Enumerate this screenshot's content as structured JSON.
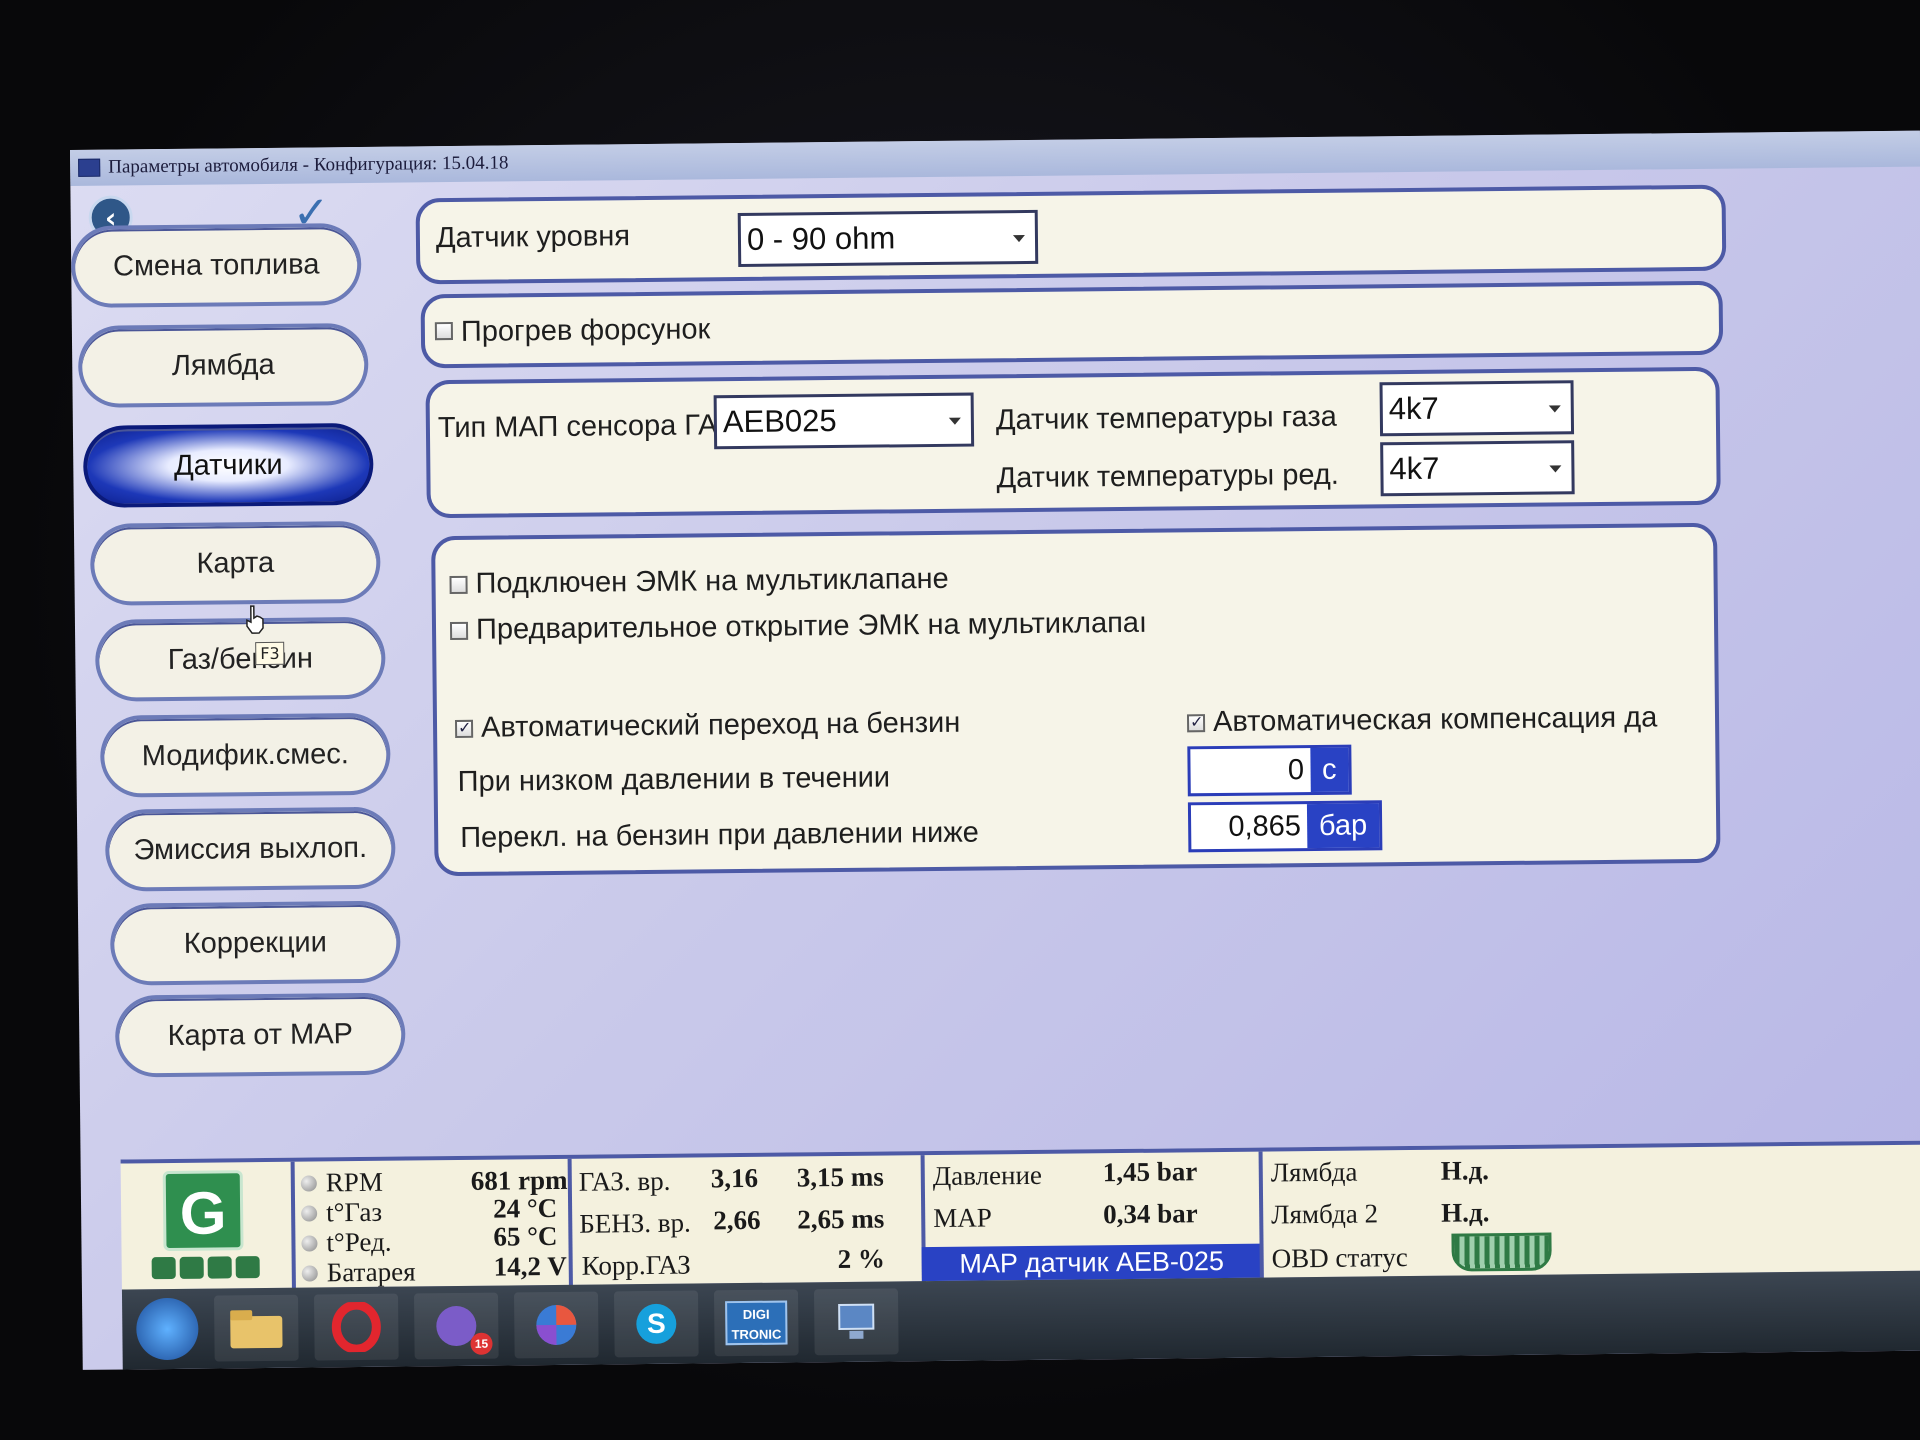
{
  "window": {
    "title": "Параметры автомобиля - Конфигурация: 15.04.18"
  },
  "nav": {
    "items": [
      {
        "label": "Смена топлива"
      },
      {
        "label": "Лямбда"
      },
      {
        "label": "Датчики"
      },
      {
        "label": "Карта"
      },
      {
        "label": "Газ/бензин"
      },
      {
        "label": "Модифик.смес."
      },
      {
        "label": "Эмиссия выхлоп."
      },
      {
        "label": "Коррекции"
      },
      {
        "label": "Карта от MAP"
      }
    ],
    "active": "Датчики",
    "tooltip": "F3"
  },
  "level_sensor": {
    "label": "Датчик уровня",
    "value": "0 - 90 ohm"
  },
  "injector_heat": {
    "label": "Прогрев форсунок",
    "checked": false
  },
  "sensors": {
    "map_type_label": "Тип МАП сенсора ГАЗа",
    "map_type_value": "AEB025",
    "gas_temp_label": "Датчик температуры газа",
    "gas_temp_value": "4k7",
    "red_temp_label": "Датчик температуры ред.",
    "red_temp_value": "4k7"
  },
  "emk": {
    "connected_label": "Подключен ЭМК на мультиклапане",
    "connected_checked": false,
    "preopen_label": "Предварительное открытие ЭМК на мультиклапаı",
    "preopen_checked": false,
    "auto_switch_label": "Автоматический переход на бензин",
    "auto_switch_checked": true,
    "auto_comp_label": "Автоматическая компенсация да",
    "auto_comp_checked": true,
    "low_pressure_label": "При низком давлении в течении",
    "low_pressure_value": "0",
    "low_pressure_unit": "с",
    "switch_pressure_label": "Перекл. на бензин при давлении ниже",
    "switch_pressure_value": "0,865",
    "switch_pressure_unit": "бар"
  },
  "status": {
    "g_letter": "G",
    "rpm_label": "RPM",
    "rpm_value": "681 rpm",
    "tgas_label": "t°Газ",
    "tgas_value": "24 °C",
    "tred_label": "t°Ред.",
    "tred_value": "65 °C",
    "battery_label": "Батарея",
    "battery_value": "14,2 V",
    "gas_time_label": "ГАЗ. вр.",
    "gas_time_a": "3,16",
    "gas_time_b": "3,15 ms",
    "petrol_time_label": "БЕНЗ. вр.",
    "petrol_time_a": "2,66",
    "petrol_time_b": "2,65 ms",
    "corr_label": "Корр.ГАЗ",
    "corr_value": "2 %",
    "pressure_label": "Давление",
    "pressure_value": "1,45 bar",
    "map_label": "MAP",
    "map_value": "0,34 bar",
    "map_sensor_band": "MAP датчик AEB-025",
    "lambda_label": "Лямбда",
    "lambda_value": "Н.д.",
    "lambda2_label": "Лямбда 2",
    "lambda2_value": "Н.д.",
    "obd_label": "OBD статус"
  },
  "taskbar": {
    "viber_badge": "15",
    "digitronic_label": "DIGI TRONIC"
  }
}
